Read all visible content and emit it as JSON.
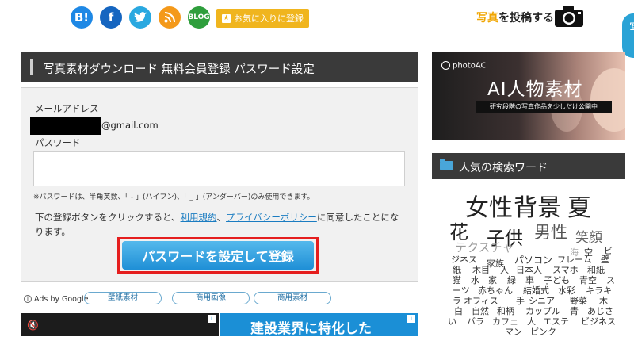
{
  "header": {
    "social": [
      "B!",
      "f",
      "t",
      "rss",
      "BLOG"
    ],
    "favorite_label": "お気に入りに登録",
    "post_prefix": "写真",
    "post_suffix": "を投稿する"
  },
  "main": {
    "title": "写真素材ダウンロード 無料会員登録 パスワード設定",
    "email_label": "メールアドレス",
    "email_suffix": "@gmail.com",
    "password_label": "パスワード",
    "password_value": "",
    "note": "※パスワードは、半角英数、「 - 」(ハイフン)、「 _ 」(アンダーバー)のみ使用できます。",
    "agree_pre": "下の登録ボタンをクリックすると、",
    "terms_link": "利用規約",
    "sep": "、",
    "privacy_link": "プライバシーポリシー",
    "agree_post": "に同意したことになります。",
    "submit_label": "パスワードを設定して登録"
  },
  "ads": {
    "ads_by": "Ads by Google",
    "links": [
      "壁紙素材",
      "商用画像",
      "商用素材"
    ],
    "banner_text": "建設業界に特化した"
  },
  "sidebar": {
    "promo_brand": "photoAC",
    "promo_title": "AI人物素材",
    "promo_sub": "研究段階の写真作品を少しだけ公開中",
    "keywords_title": "人気の検索ワード",
    "tags": [
      "女性",
      "背景",
      "夏",
      "花",
      "子供",
      "男性",
      "笑顔",
      "テクスチャ",
      "空",
      "海",
      "ビ",
      "ジネス",
      "紙",
      "家族",
      "パソコン",
      "フレーム",
      "壁",
      "木目",
      "人",
      "日本人",
      "スマホ",
      "和紙",
      "猫",
      "水",
      "家",
      "緑",
      "車",
      "子ども",
      "青空",
      "ス",
      "ーツ",
      "赤ちゃん",
      "結婚式",
      "水彩",
      "キラキ",
      "ラ",
      "オフィス",
      "手",
      "シニア",
      "野菜",
      "木",
      "白",
      "自然",
      "和柄",
      "カップル",
      "青",
      "あじさ",
      "い",
      "バラ",
      "カフェ",
      "人",
      "エステ",
      "ビジネス",
      "マン",
      "ピンク"
    ]
  }
}
